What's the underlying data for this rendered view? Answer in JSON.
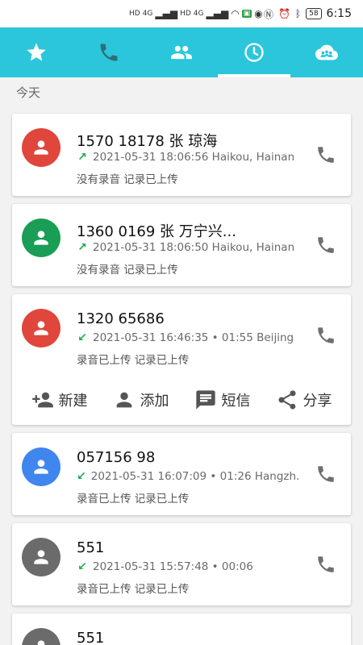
{
  "status_bar": {
    "left_icons": [
      "HD",
      "4G",
      "HD",
      "4G",
      "wifi-icon",
      "data-saver-icon",
      "location-icon"
    ],
    "battery": "58",
    "time": "6:15"
  },
  "tabs": [
    {
      "name": "favorites",
      "icon": "star-icon",
      "active": false
    },
    {
      "name": "calls",
      "icon": "phone-icon",
      "active": false
    },
    {
      "name": "contacts",
      "icon": "people-icon",
      "active": false
    },
    {
      "name": "history",
      "icon": "clock-icon",
      "active": true
    },
    {
      "name": "groups",
      "icon": "cloud-group-icon",
      "active": false
    }
  ],
  "colors": {
    "tabbar": "#2bc6db",
    "avatar_red": "#e0463c",
    "avatar_green": "#1a9e55",
    "avatar_blue": "#3f86ee",
    "avatar_gray": "#6b6b6b",
    "outgoing_arrow": "#1faa54"
  },
  "section_header": "今天",
  "calls": [
    {
      "number": "1570 18178 张 琼海",
      "arrow": "↗",
      "meta": "2021-05-31 18:06:56 Haikou, Hainan",
      "status": "没有录音 记录已上传",
      "avatar_color": "#e0463c"
    },
    {
      "number": "1360 0169 张 万宁兴...",
      "arrow": "↗",
      "meta": "2021-05-31 18:06:50 Haikou, Hainan",
      "status": "没有录音 记录已上传",
      "avatar_color": "#1a9e55"
    },
    {
      "number": "1320 65686",
      "arrow": "↙",
      "meta": "2021-05-31 16:46:35 • 01:55 Beijing",
      "status": "录音已上传 记录已上传",
      "avatar_color": "#e0463c",
      "actions": [
        {
          "label": "新建",
          "icon": "add-person-icon"
        },
        {
          "label": "添加",
          "icon": "person-icon"
        },
        {
          "label": "短信",
          "icon": "message-icon"
        },
        {
          "label": "分享",
          "icon": "share-icon"
        }
      ]
    },
    {
      "number": "057156 98",
      "arrow": "↙",
      "meta": "2021-05-31 16:07:09 • 01:26 Hangzh...",
      "status": "录音已上传 记录已上传",
      "avatar_color": "#3f86ee"
    },
    {
      "number": "551",
      "arrow": "↙",
      "meta": "2021-05-31 15:57:48 • 00:06",
      "status": "录音已上传 记录已上传",
      "avatar_color": "#6b6b6b"
    },
    {
      "number": "551",
      "arrow": "",
      "meta": "",
      "status": "",
      "avatar_color": "#6b6b6b"
    }
  ]
}
